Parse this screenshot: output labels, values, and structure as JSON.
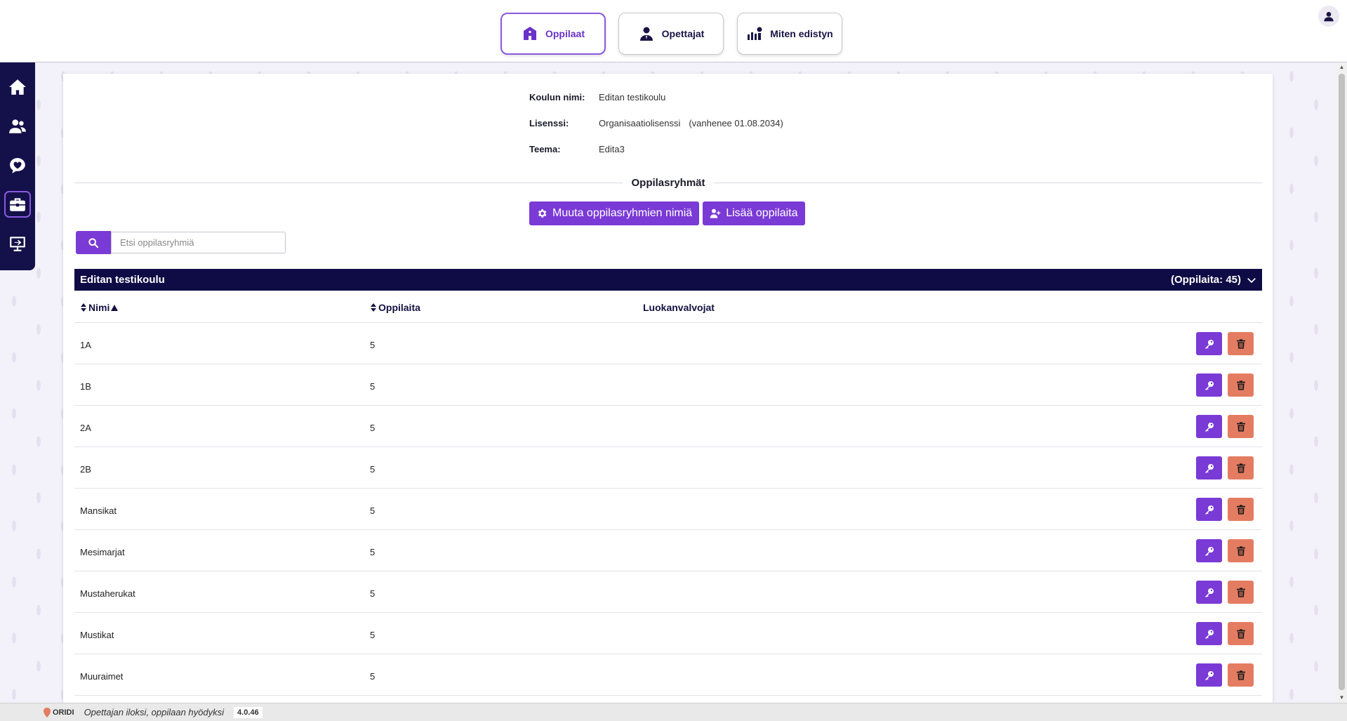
{
  "nav": {
    "tabs": [
      {
        "label": "Oppilaat",
        "icon": "school-icon",
        "active": true
      },
      {
        "label": "Opettajat",
        "icon": "teacher-icon",
        "active": false
      },
      {
        "label": "Miten edistyn",
        "icon": "progress-chart-icon",
        "active": false
      }
    ]
  },
  "sidebar": {
    "items": [
      {
        "icon": "home-icon"
      },
      {
        "icon": "users-icon"
      },
      {
        "icon": "heart-bubble-icon"
      },
      {
        "icon": "briefcase-icon",
        "active": true
      },
      {
        "icon": "presentation-icon"
      }
    ]
  },
  "school": {
    "name_label": "Koulun nimi:",
    "name": "Editan testikoulu",
    "license_label": "Lisenssi:",
    "license": "Organisaatiolisenssi",
    "license_expiry": "(vanhenee 01.08.2034)",
    "theme_label": "Teema:",
    "theme": "Edita3"
  },
  "groups_section": {
    "title": "Oppilasryhmät",
    "rename_button": "Muuta oppilasryhmien nimiä",
    "add_students_button": "Lisää oppilaita",
    "search_placeholder": "Etsi oppilasryhmiä"
  },
  "group_bar": {
    "title": "Editan testikoulu",
    "count_text": "(Oppilaita: 45)"
  },
  "table": {
    "columns": [
      "Nimi",
      "Oppilaita",
      "Luokanvalvojat"
    ],
    "rows": [
      {
        "name": "1A",
        "count": "5"
      },
      {
        "name": "1B",
        "count": "5"
      },
      {
        "name": "2A",
        "count": "5"
      },
      {
        "name": "2B",
        "count": "5"
      },
      {
        "name": "Mansikat",
        "count": "5"
      },
      {
        "name": "Mesimarjat",
        "count": "5"
      },
      {
        "name": "Mustaherukat",
        "count": "5"
      },
      {
        "name": "Mustikat",
        "count": "5"
      },
      {
        "name": "Muuraimet",
        "count": "5"
      }
    ]
  },
  "footer": {
    "brand": "ORIDI",
    "tagline": "Opettajan iloksi, oppilaan hyödyksi",
    "version": "4.0.46"
  },
  "colors": {
    "primary": "#7a3ad6",
    "navy": "#0f0b45",
    "danger": "#e47c62"
  }
}
